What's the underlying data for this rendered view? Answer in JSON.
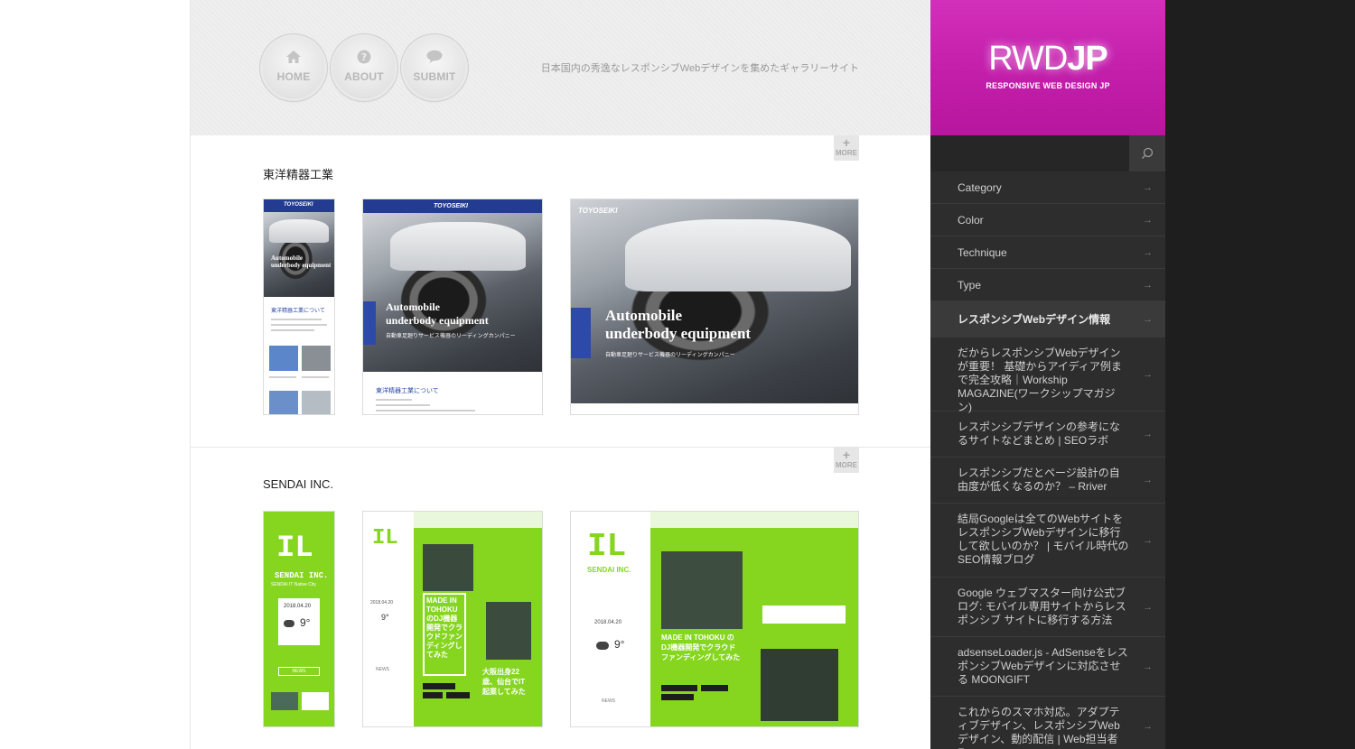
{
  "nav": {
    "home": "HOME",
    "about": "ABOUT",
    "submit": "SUBMIT"
  },
  "tagline": "日本国内の秀逸なレスポンシブWebデザインを集めたギャラリーサイト",
  "more_label": "MORE",
  "sites": [
    {
      "title": "東洋精器工業",
      "thumb": {
        "logo": "TOYOSEIKI",
        "headline_1": "Automobile",
        "headline_2": "underbody equipment",
        "subline": "自動車足廻りサービス機器のリーディングカンパニー",
        "about": "東洋精器工業について"
      }
    },
    {
      "title": "SENDAI INC.",
      "thumb": {
        "logo": "SENDAI INC.",
        "tagline": "SENDAI IT Native City",
        "date": "2018.04.20",
        "temp": "9°",
        "news": "NEWS",
        "feature": "MADE IN TOHOKU のDJ機器開発でクラウドファンディングしてみた",
        "feature2": "大阪出身22歳、仙台でIT起業してみた"
      }
    }
  ],
  "sidebar": {
    "brand_light": "RWD",
    "brand_bold": "JP",
    "brand_sub": "RESPONSIVE WEB DESIGN JP",
    "search_placeholder": "",
    "menu": [
      {
        "label": "Category"
      },
      {
        "label": "Color"
      },
      {
        "label": "Technique"
      },
      {
        "label": "Type"
      }
    ],
    "section_heading": "レスポンシブWebデザイン情報",
    "links": [
      {
        "label": "だからレスポンシブWebデザインが重要！ 基礎からアイディア例まで完全攻略｜Workship MAGAZINE(ワークシップマガジン)"
      },
      {
        "label": "レスポンシブデザインの参考になるサイトなどまとめ | SEOラボ"
      },
      {
        "label": "レスポンシブだとページ設計の自由度が低くなるのか？ – Rriver"
      },
      {
        "label": "結局Googleは全てのWebサイトをレスポンシブWebデザインに移行して欲しいのか？ | モバイル時代のSEO情報ブログ"
      },
      {
        "label": "Google ウェブマスター向け公式ブログ: モバイル専用サイトからレスポンシブ サイトに移行する方法"
      },
      {
        "label": "adsenseLoader.js - AdSenseをレスポンシブWebデザインに対応させる MOONGIFT"
      },
      {
        "label": "これからのスマホ対応。アダプティブデザイン、レスポンシブWebデザイン、動的配信 | Web担当者Forum"
      }
    ]
  },
  "colors": {
    "brand_magenta": "#c21eaa",
    "sidebar_bg": "#2d2d2d",
    "sendai_green": "#86d620",
    "toyoseiki_blue": "#233c92"
  }
}
